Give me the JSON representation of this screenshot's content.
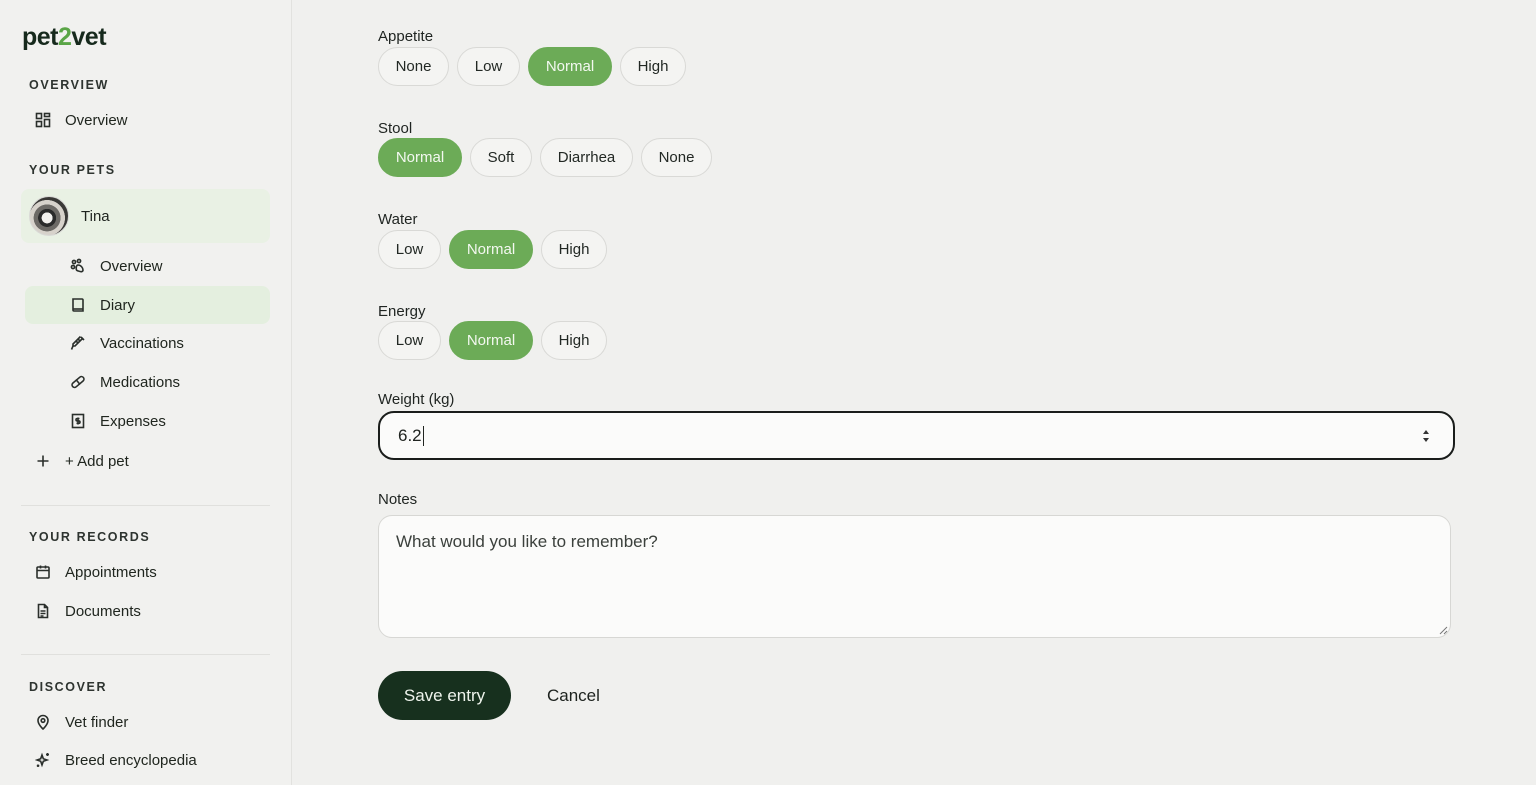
{
  "brand": {
    "logo_prefix": "pet",
    "logo_digit": "2",
    "logo_suffix": "vet"
  },
  "sidebar": {
    "sections": {
      "overview": "OVERVIEW",
      "your_pets": "YOUR PETS",
      "your_records": "YOUR RECORDS",
      "discover": "DISCOVER"
    },
    "overview_item": {
      "label": "Overview",
      "icon": "grid-icon"
    },
    "pet": {
      "name": "Tina"
    },
    "pet_items": [
      {
        "label": "Overview",
        "icon": "paw-icon"
      },
      {
        "label": "Diary",
        "icon": "book-icon",
        "active": true
      },
      {
        "label": "Vaccinations",
        "icon": "syringe-icon"
      },
      {
        "label": "Medications",
        "icon": "pill-icon"
      },
      {
        "label": "Expenses",
        "icon": "receipt-icon"
      }
    ],
    "add_pet": {
      "label": "+ Add pet",
      "icon": "plus-icon"
    },
    "records_items": [
      {
        "label": "Appointments",
        "icon": "calendar-icon"
      },
      {
        "label": "Documents",
        "icon": "document-icon"
      }
    ],
    "discover_items": [
      {
        "label": "Vet finder",
        "icon": "map-pin-icon"
      },
      {
        "label": "Breed encyclopedia",
        "icon": "sparkles-icon"
      }
    ]
  },
  "form": {
    "appetite": {
      "label": "Appetite",
      "options": [
        "None",
        "Low",
        "Normal",
        "High"
      ],
      "selected": "Normal"
    },
    "stool": {
      "label": "Stool",
      "options": [
        "Normal",
        "Soft",
        "Diarrhea",
        "None"
      ],
      "selected": "Normal"
    },
    "water": {
      "label": "Water",
      "options": [
        "Low",
        "Normal",
        "High"
      ],
      "selected": "Normal"
    },
    "energy": {
      "label": "Energy",
      "options": [
        "Low",
        "Normal",
        "High"
      ],
      "selected": "Normal"
    },
    "weight": {
      "label": "Weight (kg)",
      "value": "6.2"
    },
    "notes": {
      "label": "Notes",
      "placeholder": "What would you like to remember?"
    },
    "save_label": "Save entry",
    "cancel_label": "Cancel"
  },
  "colors": {
    "accent_green": "#6cab57",
    "dark_button": "#17301e",
    "active_nav_bg": "#e4efdf"
  }
}
